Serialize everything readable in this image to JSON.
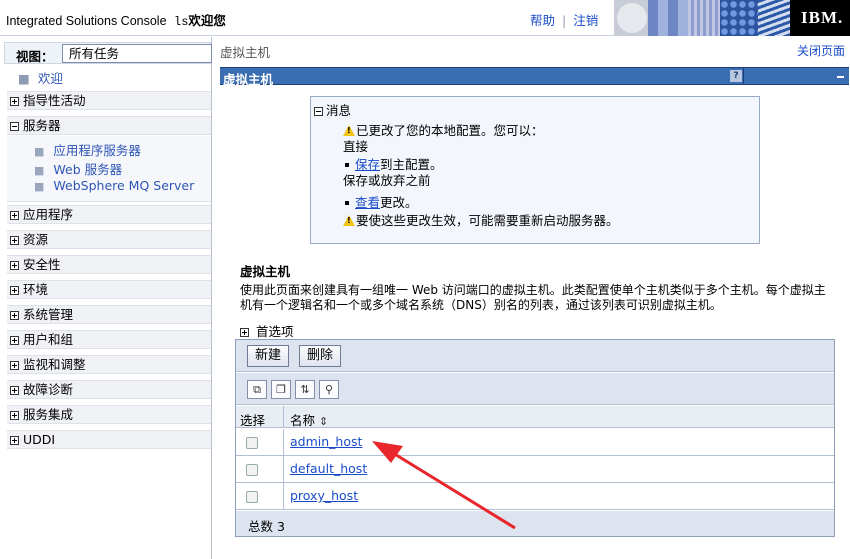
{
  "banner": {
    "title": "Integrated Solutions Console",
    "user": "ls",
    "welcome": "欢迎您",
    "help": "帮助",
    "separator": "|",
    "logout": "注销",
    "logo": "IBM."
  },
  "nav": {
    "view_label": "视图：",
    "view_value": "所有任务",
    "welcome": "欢迎",
    "items": [
      {
        "label": "指导性活动",
        "expanded": false
      },
      {
        "label": "服务器",
        "expanded": true
      },
      {
        "label": "应用程序",
        "expanded": false
      },
      {
        "label": "资源",
        "expanded": false
      },
      {
        "label": "安全性",
        "expanded": false
      },
      {
        "label": "环境",
        "expanded": false
      },
      {
        "label": "系统管理",
        "expanded": false
      },
      {
        "label": "用户和组",
        "expanded": false
      },
      {
        "label": "监视和调整",
        "expanded": false
      },
      {
        "label": "故障诊断",
        "expanded": false
      },
      {
        "label": "服务集成",
        "expanded": false
      },
      {
        "label": "UDDI",
        "expanded": false
      }
    ],
    "server_links": [
      "应用程序服务器",
      "Web 服务器",
      "WebSphere MQ Server"
    ]
  },
  "content": {
    "breadcrumb": "虚拟主机",
    "close_page": "关闭页面",
    "title": "虚拟主机",
    "help": "?"
  },
  "messages": {
    "header": "消息",
    "line1": "已更改了您的本地配置。您可以：",
    "line2": "直接",
    "save_link": "保存",
    "save_rest": "到主配置。",
    "line4": "保存或放弃之前",
    "review_link": "查看",
    "review_rest": "更改。",
    "line6": "要使这些更改生效，可能需要重新启动服务器。"
  },
  "section": {
    "title": "虚拟主机",
    "desc_line1": "使用此页面来创建具有一组唯一 Web 访问端口的虚拟主机。此类配置使单个主机类似于多个主机。每个虚拟主",
    "desc_line2": "机有一个逻辑名和一个或多个域名系统（DNS）别名的列表，通过该列表可识别虚拟主机。",
    "preferences": "首选项"
  },
  "table": {
    "new_button": "新建",
    "delete_button": "删除",
    "col_select": "选择",
    "col_name": "名称",
    "rows": [
      "admin_host",
      "default_host",
      "proxy_host"
    ],
    "total": "总数 3"
  },
  "colors": {
    "title_bar": "#3a6db1",
    "link": "#1a4cc9",
    "annotation_arrow": "#e8262b"
  }
}
